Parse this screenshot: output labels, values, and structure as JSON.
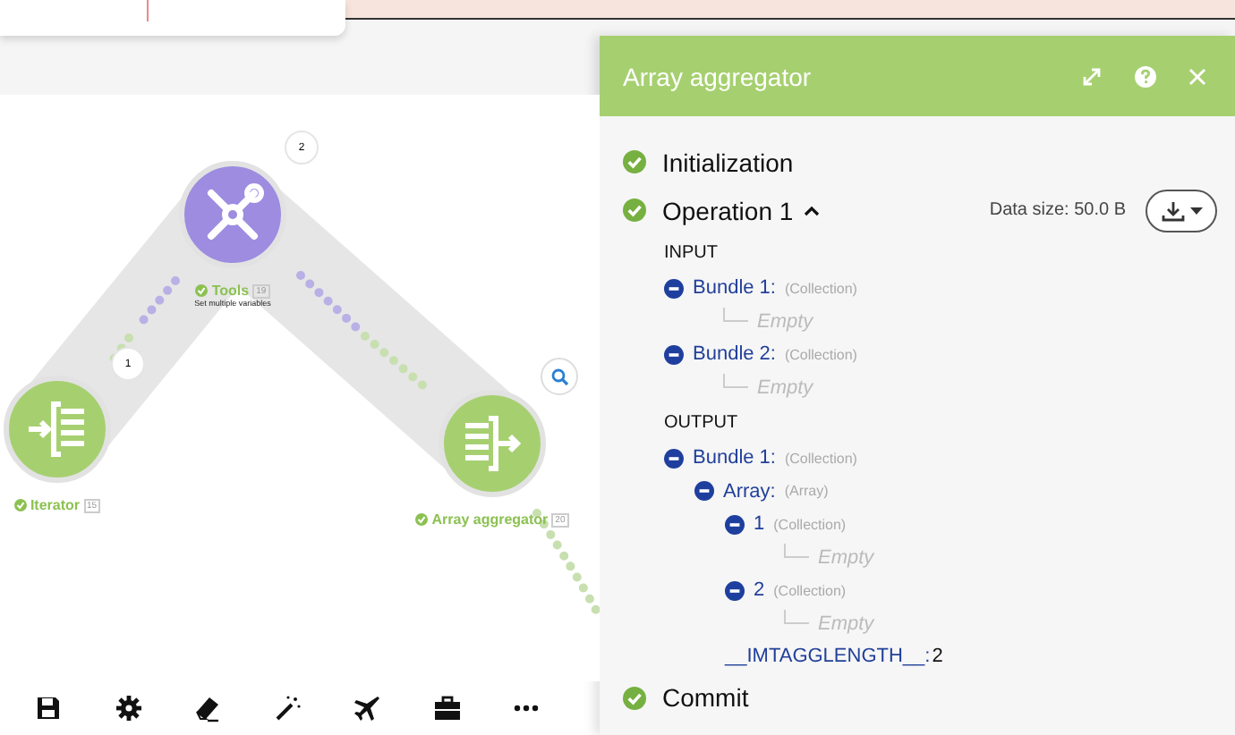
{
  "scenario": {
    "modules": [
      {
        "name": "Tools",
        "count": "19",
        "subtitle": "Set multiple variables",
        "kind": "tools",
        "done": true,
        "color": "#9d8ce0"
      },
      {
        "name": "Iterator",
        "count": "15",
        "kind": "iterator",
        "done": true,
        "color": "#a6d070"
      },
      {
        "name": "Array aggregator",
        "count": "20",
        "kind": "aggregator",
        "done": true,
        "color": "#a6d070"
      }
    ],
    "bubbles": [
      {
        "label": "2"
      },
      {
        "label": "1"
      }
    ]
  },
  "panel": {
    "title": "Array aggregator",
    "steps": [
      {
        "label": "Initialization",
        "done": true
      },
      {
        "label": "Operation 1",
        "done": true,
        "expanded": true,
        "data_size": "Data size: 50.0 B",
        "sections": [
          {
            "heading": "INPUT",
            "items": [
              {
                "kind": "collection",
                "label": "Bundle 1:",
                "type": "(Collection)",
                "expanded": true,
                "children": [
                  {
                    "kind": "empty",
                    "label": "Empty"
                  }
                ]
              },
              {
                "kind": "collection",
                "label": "Bundle 2:",
                "type": "(Collection)",
                "expanded": true,
                "children": [
                  {
                    "kind": "empty",
                    "label": "Empty"
                  }
                ]
              }
            ]
          },
          {
            "heading": "OUTPUT",
            "items": [
              {
                "kind": "collection",
                "label": "Bundle 1:",
                "type": "(Collection)",
                "expanded": true,
                "children": [
                  {
                    "kind": "collection",
                    "label": "Array:",
                    "type": "(Array)",
                    "expanded": true,
                    "children": [
                      {
                        "kind": "collection",
                        "label": "1",
                        "type": "(Collection)",
                        "expanded": true,
                        "children": [
                          {
                            "kind": "empty",
                            "label": "Empty"
                          }
                        ]
                      },
                      {
                        "kind": "collection",
                        "label": "2",
                        "type": "(Collection)",
                        "expanded": true,
                        "children": [
                          {
                            "kind": "empty",
                            "label": "Empty"
                          }
                        ]
                      },
                      {
                        "kind": "value",
                        "label": "__IMTAGGLENGTH__:",
                        "value": "2"
                      }
                    ]
                  }
                ]
              }
            ]
          }
        ]
      },
      {
        "label": "Commit",
        "done": true
      }
    ]
  }
}
